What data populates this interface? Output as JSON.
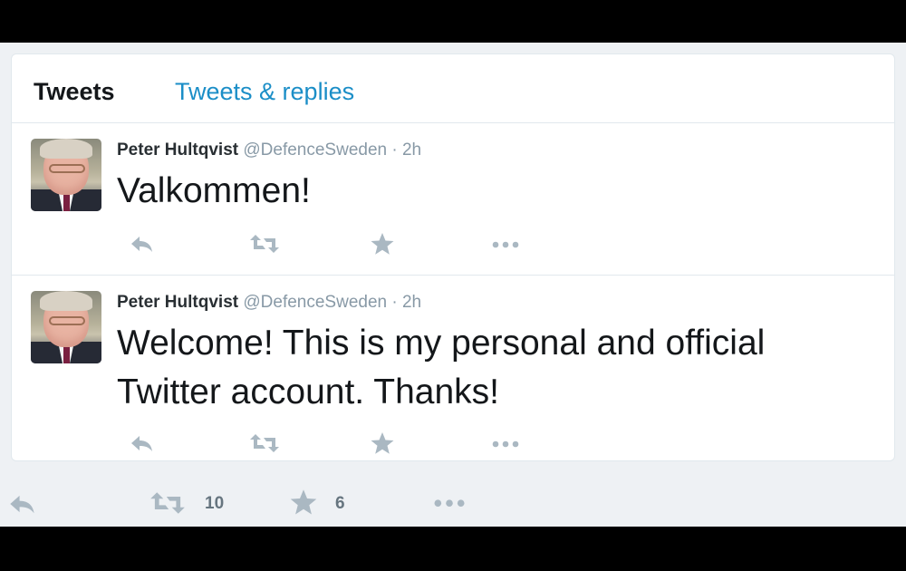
{
  "tabs": {
    "active": "Tweets",
    "other": "Tweets & replies"
  },
  "tweets": [
    {
      "name": "Peter Hultqvist",
      "handle": "@DefenceSweden",
      "separator": "·",
      "time": "2h",
      "text": "Valkommen!"
    },
    {
      "name": "Peter Hultqvist",
      "handle": "@DefenceSweden",
      "separator": "·",
      "time": "2h",
      "text": "Welcome! This is my personal and official Twitter account. Thanks!"
    }
  ],
  "bottom_bar": {
    "retweet_count": "10",
    "favorite_count": "6"
  },
  "colors": {
    "link": "#1b8ec7",
    "icon": "#aab8c2",
    "muted": "#8899a6",
    "background": "#eef1f4"
  },
  "icons": [
    "reply-icon",
    "retweet-icon",
    "favorite-star-icon",
    "more-icon"
  ]
}
